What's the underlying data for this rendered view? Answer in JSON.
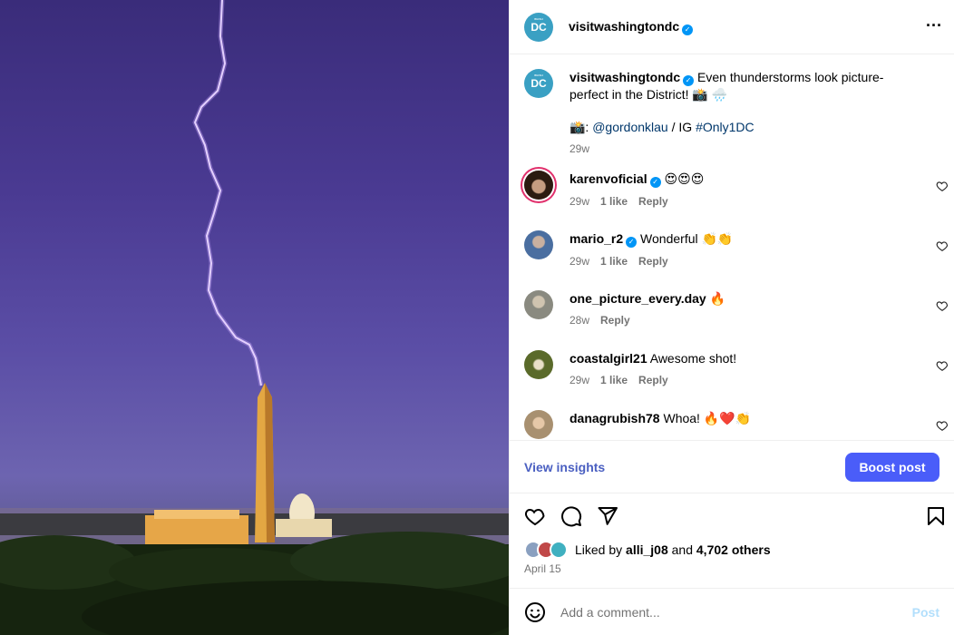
{
  "post": {
    "author": "visitwashingtondc",
    "avatar_text": "DC",
    "avatar_tiny": "WASH",
    "verified": true
  },
  "caption": {
    "author": "visitwashingtondc",
    "text": "Even thunderstorms look picture-perfect in the District! 📸 🌧️",
    "credit_prefix": "📸: ",
    "credit_mention": "@gordonklau",
    "credit_mid": " / IG ",
    "credit_hashtag": "#Only1DC",
    "time": "29w"
  },
  "comments": [
    {
      "user": "karenvoficial",
      "verified": true,
      "text": "😍😍😍",
      "time": "29w",
      "likes": "1 like",
      "reply": "Reply",
      "avatar_color": "#2b1b10"
    },
    {
      "user": "mario_r2",
      "verified": true,
      "text": "Wonderful 👏👏",
      "time": "29w",
      "likes": "1 like",
      "reply": "Reply",
      "avatar_color": "#4a6ea0"
    },
    {
      "user": "one_picture_every.day",
      "verified": false,
      "text": "🔥",
      "time": "28w",
      "likes": "",
      "reply": "Reply",
      "avatar_color": "#8a8a80"
    },
    {
      "user": "coastalgirl21",
      "verified": false,
      "text": "Awesome shot!",
      "time": "29w",
      "likes": "1 like",
      "reply": "Reply",
      "avatar_color": "#5a6a2a"
    },
    {
      "user": "danagrubish78",
      "verified": false,
      "text": "Whoa! 🔥❤️👏",
      "time": "",
      "likes": "",
      "reply": "",
      "avatar_color": "#a89070"
    }
  ],
  "actions": {
    "insights": "View insights",
    "boost": "Boost post"
  },
  "likes": {
    "prefix": "Liked by ",
    "user": "alli_j08",
    "mid": " and ",
    "count": "4,702 others"
  },
  "date": "April 15",
  "comment_input": {
    "placeholder": "Add a comment...",
    "post": "Post"
  },
  "icons": [
    "heart-icon",
    "comment-icon",
    "share-icon",
    "bookmark-icon",
    "emoji-icon",
    "more-icon",
    "verified-icon"
  ],
  "colors": {
    "accent": "#4a5df9",
    "verified": "#0095f6",
    "avatar": "#3aa0c3"
  }
}
